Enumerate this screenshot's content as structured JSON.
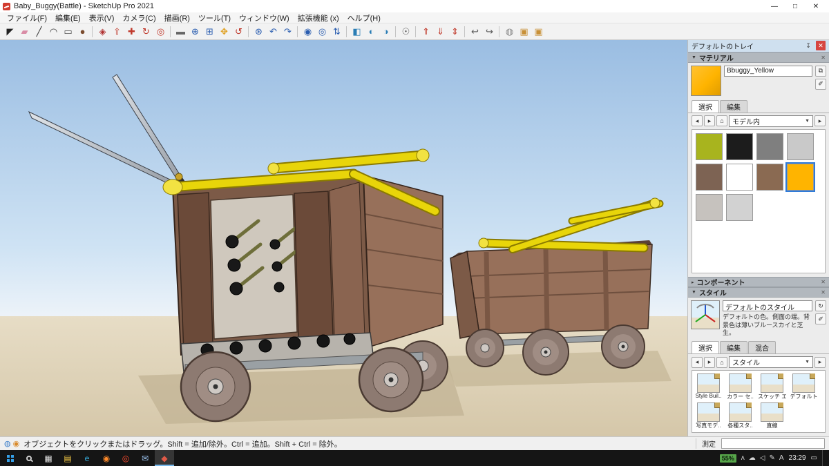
{
  "colors": {
    "sky_top": "#9abde2",
    "sky_mid": "#cfe3f4",
    "sky_bottom": "#edf3f9",
    "ground": "#d5c7a9",
    "ground_light": "#e7ddc6",
    "shadow": "#c2b394",
    "wood": "#7c5a47",
    "wood_dark": "#6b4a39",
    "wood_light": "#97705a",
    "metal": "#b7b3ac",
    "bamboo": "#e8d50a",
    "bamboo_dark": "#8a7a00",
    "wheel": "#8d7a71",
    "selection_blue": "#2f7bd9",
    "material_yellow": "#ffb400",
    "taskbar_bg": "#151515",
    "battery_green": "#57a64a"
  },
  "window": {
    "title": "Baby_Buggy(Battle) - SketchUp Pro 2021",
    "controls": {
      "minimize": "—",
      "restore": "□",
      "close": "✕"
    }
  },
  "menu": {
    "items": [
      "ファイル(F)",
      "編集(E)",
      "表示(V)",
      "カメラ(C)",
      "描画(R)",
      "ツール(T)",
      "ウィンドウ(W)",
      "拡張機能 (x)",
      "ヘルプ(H)"
    ]
  },
  "toolbar": {
    "icons": [
      {
        "name": "select-tool-icon",
        "glyph": "◤",
        "color": "#222222"
      },
      {
        "name": "eraser-tool-icon",
        "glyph": "▰",
        "color": "#d98ca6"
      },
      {
        "name": "line-tool-icon",
        "glyph": "╱",
        "color": "#333333"
      },
      {
        "name": "arc-tool-icon",
        "glyph": "◠",
        "color": "#333333"
      },
      {
        "name": "rectangle-tool-icon",
        "glyph": "▭",
        "color": "#555555"
      },
      {
        "name": "circle-tool-icon",
        "glyph": "●",
        "color": "#7a4b2e"
      },
      {
        "name": "paint-bucket-icon",
        "glyph": "◈",
        "color": "#b03030",
        "group_start": true
      },
      {
        "name": "push-pull-icon",
        "glyph": "⇧",
        "color": "#c0392b"
      },
      {
        "name": "move-tool-icon",
        "glyph": "✚",
        "color": "#c0392b"
      },
      {
        "name": "rotate-tool-icon",
        "glyph": "↻",
        "color": "#c0392b"
      },
      {
        "name": "offset-tool-icon",
        "glyph": "◎",
        "color": "#c0392b"
      },
      {
        "name": "tape-measure-icon",
        "glyph": "▬",
        "color": "#666666",
        "group_start": true
      },
      {
        "name": "zoom-tool-icon",
        "glyph": "⊕",
        "color": "#2a5db0"
      },
      {
        "name": "zoom-window-icon",
        "glyph": "⊞",
        "color": "#2a5db0"
      },
      {
        "name": "pan-tool-icon",
        "glyph": "✥",
        "color": "#e0a020"
      },
      {
        "name": "orbit-tool-icon",
        "glyph": "↺",
        "color": "#c0392b"
      },
      {
        "name": "zoom-extents-icon",
        "glyph": "⊛",
        "color": "#2a5db0",
        "group_start": true
      },
      {
        "name": "previous-view-icon",
        "glyph": "↶",
        "color": "#2a5db0"
      },
      {
        "name": "next-view-icon",
        "glyph": "↷",
        "color": "#2a5db0"
      },
      {
        "name": "position-camera-icon",
        "glyph": "◉",
        "color": "#2a5db0",
        "group_start": true
      },
      {
        "name": "look-around-icon",
        "glyph": "◎",
        "color": "#2a5db0"
      },
      {
        "name": "walk-tool-icon",
        "glyph": "⇅",
        "color": "#2a5db0"
      },
      {
        "name": "section-plane-icon",
        "glyph": "◧",
        "color": "#2a7db5",
        "group_start": true
      },
      {
        "name": "section-display-icon",
        "glyph": "◐",
        "color": "#2a7db5"
      },
      {
        "name": "section-cut-icon",
        "glyph": "◑",
        "color": "#2a7db5"
      },
      {
        "name": "camera-person-icon",
        "glyph": "☉",
        "color": "#555555",
        "group_start": true
      },
      {
        "name": "extension-upload-icon",
        "glyph": "⇑",
        "color": "#c0392b",
        "group_start": true
      },
      {
        "name": "extension-download-icon",
        "glyph": "⇓",
        "color": "#c0392b"
      },
      {
        "name": "extension-sync-icon",
        "glyph": "⇕",
        "color": "#c0392b"
      },
      {
        "name": "undo-view-icon",
        "glyph": "↩",
        "color": "#555555",
        "group_start": true
      },
      {
        "name": "redo-view-icon",
        "glyph": "↪",
        "color": "#555555"
      },
      {
        "name": "warehouse-icon",
        "glyph": "◍",
        "color": "#888888",
        "group_start": true
      },
      {
        "name": "components-box-icon",
        "glyph": "▣",
        "color": "#c89038"
      },
      {
        "name": "extensions-box-icon",
        "glyph": "▣",
        "color": "#c89038"
      }
    ]
  },
  "tray": {
    "title": "デフォルトのトレイ",
    "icons": {
      "pin": "↧",
      "close": "✕",
      "chevron_down": "▼",
      "chevron_right": "▸",
      "back": "◂",
      "forward": "▸",
      "home": "⌂",
      "dropdown_caret": "▼",
      "details_arrow": "▸",
      "secondary_pane": "⧉",
      "eyedropper": "✐",
      "refresh": "↻"
    },
    "materials": {
      "header": "マテリアル",
      "material_name": "Bbuggy_Yellow",
      "tabs": [
        {
          "label": "選択",
          "active": true
        },
        {
          "label": "編集"
        }
      ],
      "dropdown_value": "モデル内",
      "swatches": [
        {
          "name": "swatch-olive-green",
          "color": "#a8b41e"
        },
        {
          "name": "swatch-black",
          "color": "#1c1c1c"
        },
        {
          "name": "swatch-gray",
          "color": "#7f7f7f"
        },
        {
          "name": "swatch-light-gray",
          "color": "#c9c9c9"
        },
        {
          "name": "swatch-brown",
          "color": "#7d6353"
        },
        {
          "name": "swatch-white",
          "color": "#ffffff"
        },
        {
          "name": "swatch-dark-brown",
          "color": "#8a6a52"
        },
        {
          "name": "swatch-buggy-yellow",
          "color": "#ffb400",
          "selected": true
        },
        {
          "name": "swatch-pale-gray",
          "color": "#c6c2be"
        },
        {
          "name": "swatch-silver",
          "color": "#d2d2d2"
        }
      ]
    },
    "components": {
      "header": "コンポーネント"
    },
    "styles": {
      "header": "スタイル",
      "style_name": "デフォルトのスタイル",
      "description": "デフォルトの色。側面の端。背景色は薄いブルースカイと芝生。",
      "tabs": [
        {
          "label": "選択",
          "active": true
        },
        {
          "label": "編集"
        },
        {
          "label": "混合"
        }
      ],
      "dropdown_value": "スタイル",
      "thumbnails": [
        {
          "name": "style-thumb-style-builder",
          "label": "Style Buil.."
        },
        {
          "name": "style-thumb-color-sets",
          "label": "カラー セ.."
        },
        {
          "name": "style-thumb-sketchy",
          "label": "スケッチ エ.."
        },
        {
          "name": "style-thumb-default",
          "label": "デフォルト"
        },
        {
          "name": "style-thumb-photo-modeling",
          "label": "写真モデ.."
        },
        {
          "name": "style-thumb-assorted",
          "label": "各種スタ.."
        },
        {
          "name": "style-thumb-straight-lines",
          "label": "直線"
        }
      ]
    }
  },
  "statusbar": {
    "icons": [
      {
        "name": "geolocation-icon",
        "glyph": "◍",
        "color": "#3a7dc9"
      },
      {
        "name": "credits-icon",
        "glyph": "◉",
        "color": "#d98a2b"
      }
    ],
    "hint": "オブジェクトをクリックまたはドラッグ。Shift = 追加/除外。Ctrl = 追加。Shift + Ctrl = 除外。",
    "measure_label": "測定",
    "measure_value": ""
  },
  "taskbar": {
    "glyphs": {
      "task_view": "▦",
      "action_center": "▭"
    },
    "pinned": [
      {
        "name": "taskbar-file-explorer",
        "glyph": "▤",
        "color": "#f3c744"
      },
      {
        "name": "taskbar-edge",
        "glyph": "e",
        "color": "#38b6e8"
      },
      {
        "name": "taskbar-firefox",
        "glyph": "◉",
        "color": "#ff8a2a"
      },
      {
        "name": "taskbar-opera",
        "glyph": "◎",
        "color": "#ff4b2e"
      },
      {
        "name": "taskbar-mail",
        "glyph": "✉",
        "color": "#9cc4f0"
      },
      {
        "name": "taskbar-sketchup",
        "glyph": "◆",
        "color": "#e05a48",
        "active": true
      }
    ],
    "battery": "55%",
    "tray_icons": [
      {
        "name": "hidden-icons-chevron",
        "glyph": "ʌ"
      },
      {
        "name": "onedrive-icon",
        "glyph": "☁"
      },
      {
        "name": "volume-icon",
        "glyph": "◁"
      },
      {
        "name": "pen-icon",
        "glyph": "✎"
      },
      {
        "name": "ime-icon",
        "glyph": "A"
      }
    ],
    "time": "23:29"
  }
}
